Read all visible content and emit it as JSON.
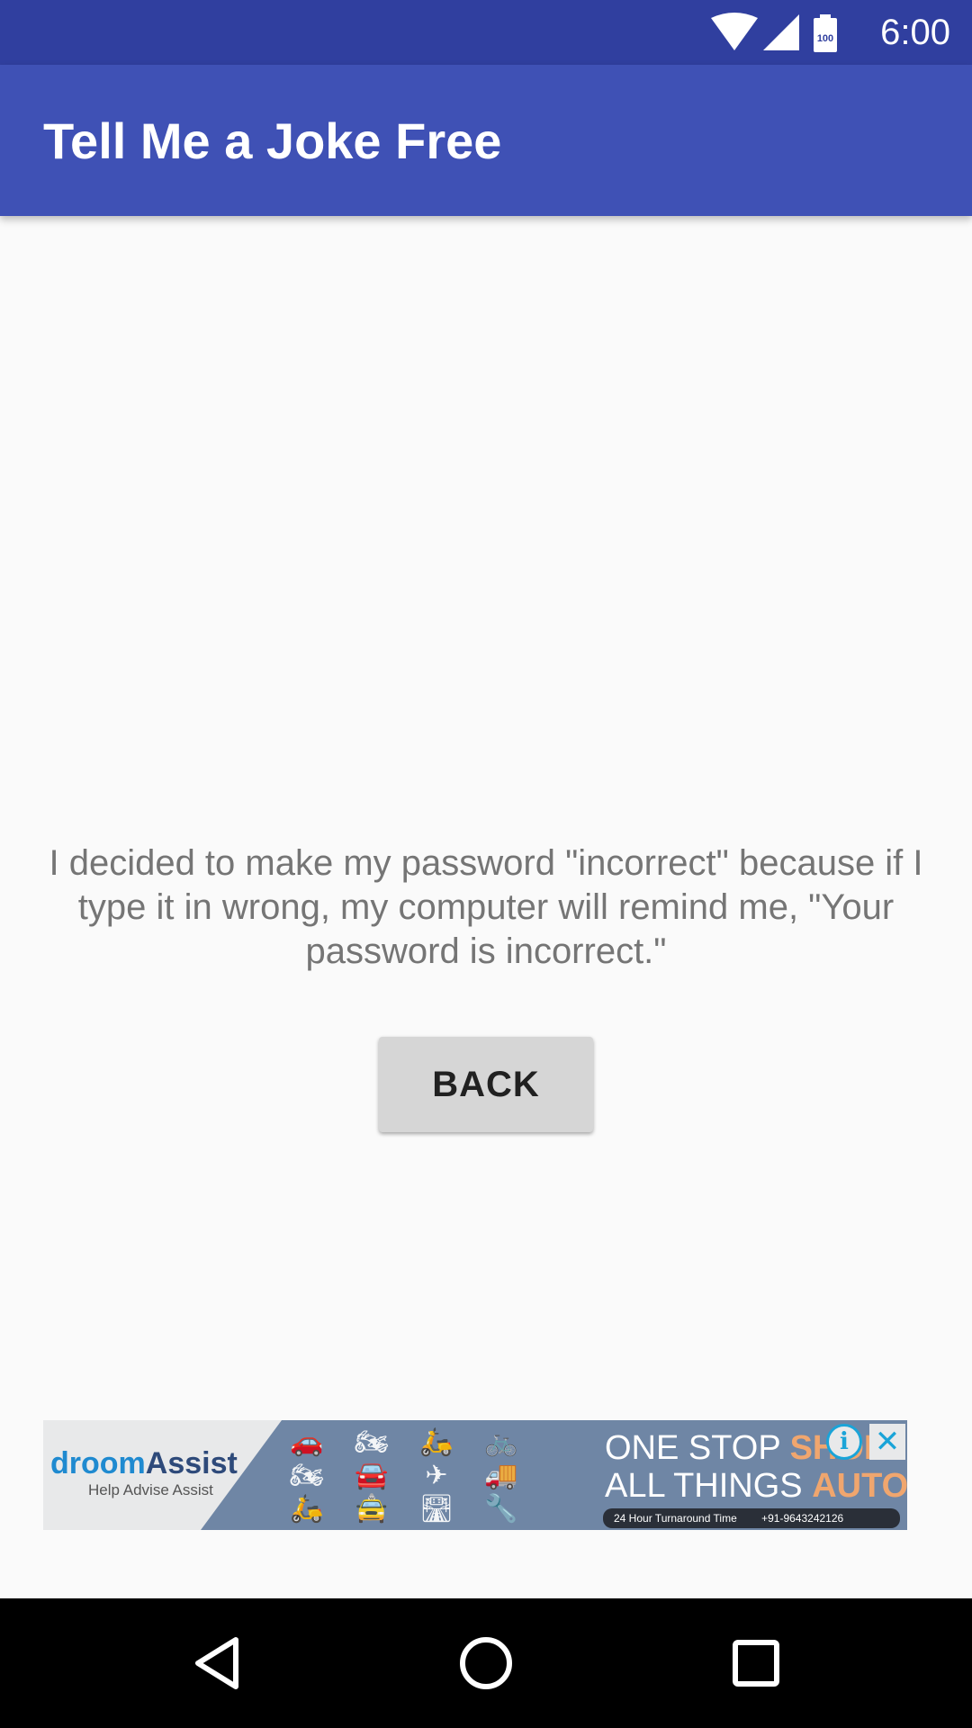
{
  "status_bar": {
    "time": "6:00",
    "battery_level": "100",
    "icons": [
      "wifi-icon",
      "cellular-signal-icon",
      "battery-icon"
    ]
  },
  "app_bar": {
    "title": "Tell Me a Joke Free"
  },
  "joke": {
    "text": "I decided to make my password \"incorrect\" because if I type it in wrong, my computer will remind me, \"Your password is incorrect.\""
  },
  "buttons": {
    "back_label": "BACK"
  },
  "ad": {
    "brand_part1": "droom",
    "brand_part2": "Assist",
    "tagline": "Help  Advise  Assist",
    "headline_line1_plain": "ONE STOP ",
    "headline_line1_highlight": "SHOP",
    "headline_line2_plain": "ALL THINGS ",
    "headline_line2_highlight": "AUTOMOBILE",
    "info_turnaround": "24 Hour Turnaround Time",
    "info_phone": "+91-9643242126",
    "icons": [
      "ad-choices-icon",
      "close-icon"
    ]
  },
  "navigation": {
    "icons": [
      "back-triangle-icon",
      "home-circle-icon",
      "recents-square-icon"
    ]
  },
  "colors": {
    "status_bar": "#303f9f",
    "app_bar": "#3f51b5",
    "background": "#fafafa",
    "joke_text": "#757575",
    "button_bg": "#d6d6d6",
    "nav_bar": "#000000"
  }
}
